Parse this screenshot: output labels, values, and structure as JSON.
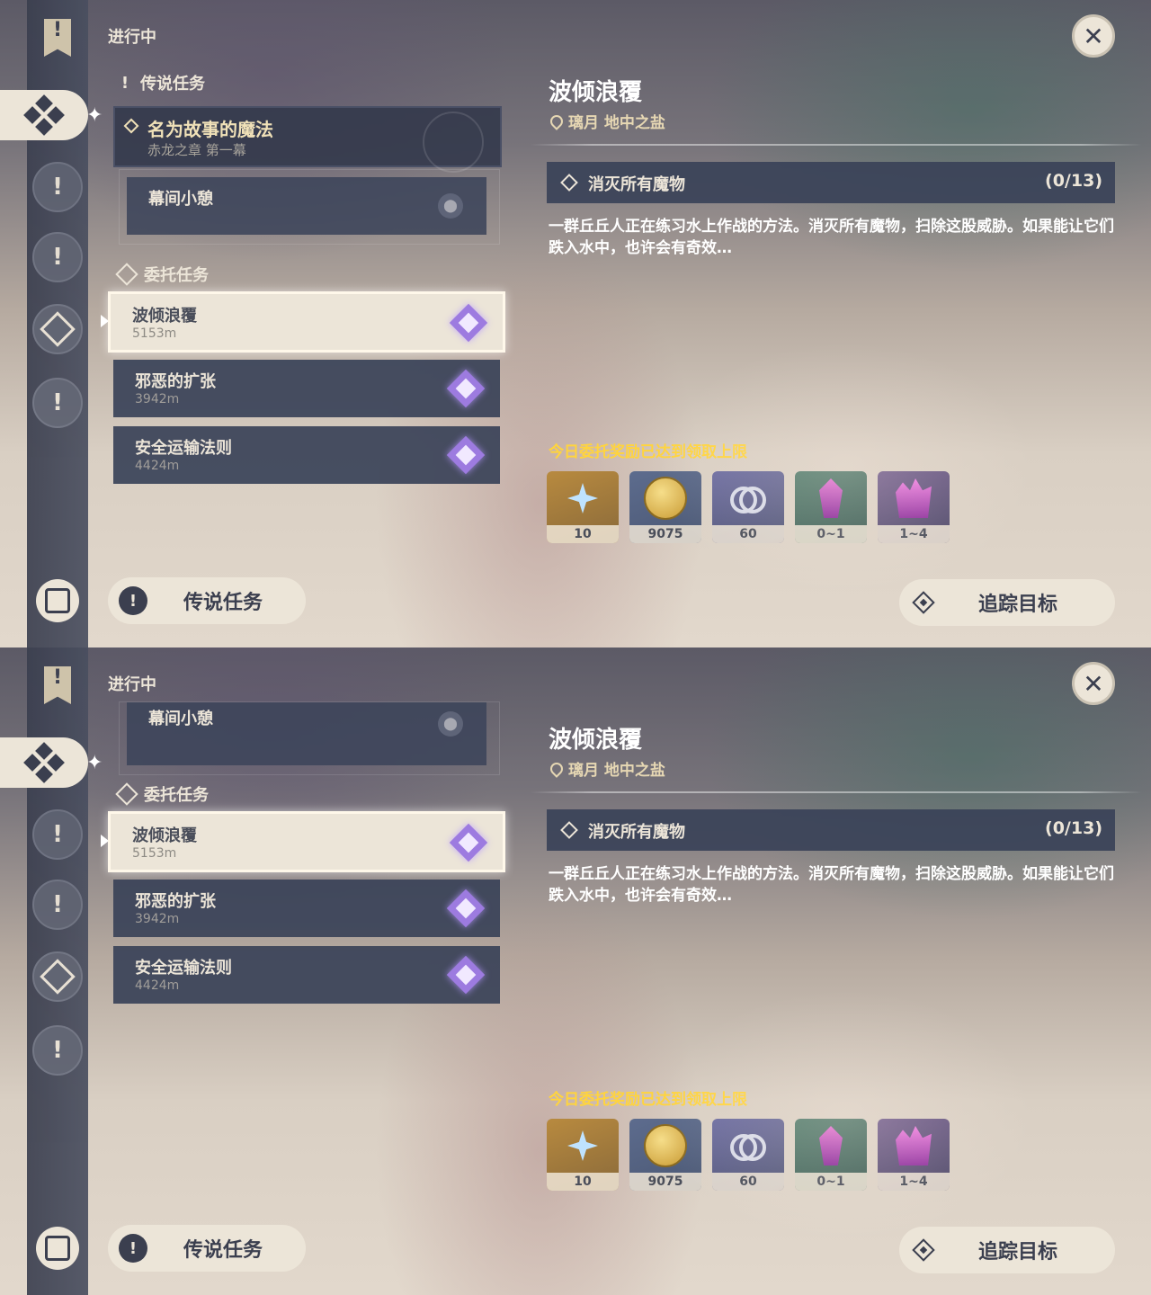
{
  "screens": [
    {
      "header": {
        "status_label": "进行中"
      },
      "legend_section": {
        "label": "传说任务"
      },
      "legend_quest": {
        "title": "名为故事的魔法",
        "subtitle": "赤龙之章 第一幕"
      },
      "legend_subquest": {
        "title": "幕间小憩"
      },
      "commission_section": {
        "label": "委托任务"
      },
      "tasks": [
        {
          "name": "波倾浪覆",
          "distance": "5153m",
          "selected": true
        },
        {
          "name": "邪恶的扩张",
          "distance": "3942m",
          "selected": false
        },
        {
          "name": "安全运输法则",
          "distance": "4424m",
          "selected": false
        }
      ],
      "bottom_left_button": "传说任务",
      "bottom_right_button": "追踪目标",
      "detail": {
        "title": "波倾浪覆",
        "location": "璃月 地中之盐",
        "objective": "消灭所有魔物",
        "objective_progress": "(0/13)",
        "description": "一群丘丘人正在练习水上作战的方法。消灭所有魔物，扫除这股威胁。如果能让它们跌入水中，也许会有奇效…",
        "reward_note": "今日委托奖励已达到领取上限",
        "rewards": [
          {
            "icon": "primogem-icon",
            "amount": "10"
          },
          {
            "icon": "mora-icon",
            "amount": "9075"
          },
          {
            "icon": "friendship-exp-icon",
            "amount": "60"
          },
          {
            "icon": "crystal-chunk-icon",
            "amount": "0~1"
          },
          {
            "icon": "crystal-cluster-icon",
            "amount": "1~4"
          }
        ]
      }
    },
    {
      "header": {
        "status_label": "进行中"
      },
      "legend_subquest": {
        "title": "幕间小憩"
      },
      "commission_section": {
        "label": "委托任务"
      },
      "tasks": [
        {
          "name": "波倾浪覆",
          "distance": "5153m",
          "selected": true
        },
        {
          "name": "邪恶的扩张",
          "distance": "3942m",
          "selected": false
        },
        {
          "name": "安全运输法则",
          "distance": "4424m",
          "selected": false
        }
      ],
      "bottom_left_button": "传说任务",
      "bottom_right_button": "追踪目标",
      "detail": {
        "title": "波倾浪覆",
        "location": "璃月 地中之盐",
        "objective": "消灭所有魔物",
        "objective_progress": "(0/13)",
        "description": "一群丘丘人正在练习水上作战的方法。消灭所有魔物，扫除这股威胁。如果能让它们跌入水中，也许会有奇效…",
        "reward_note": "今日委托奖励已达到领取上限",
        "rewards": [
          {
            "icon": "primogem-icon",
            "amount": "10"
          },
          {
            "icon": "mora-icon",
            "amount": "9075"
          },
          {
            "icon": "friendship-exp-icon",
            "amount": "60"
          },
          {
            "icon": "crystal-chunk-icon",
            "amount": "0~1"
          },
          {
            "icon": "crystal-cluster-icon",
            "amount": "1~4"
          }
        ]
      }
    }
  ],
  "colors": {
    "accent_gold": "#ffd43d",
    "panel_dark": "#3a4258",
    "panel_light": "#ece5d8",
    "commission_star": "#9d7be0"
  }
}
